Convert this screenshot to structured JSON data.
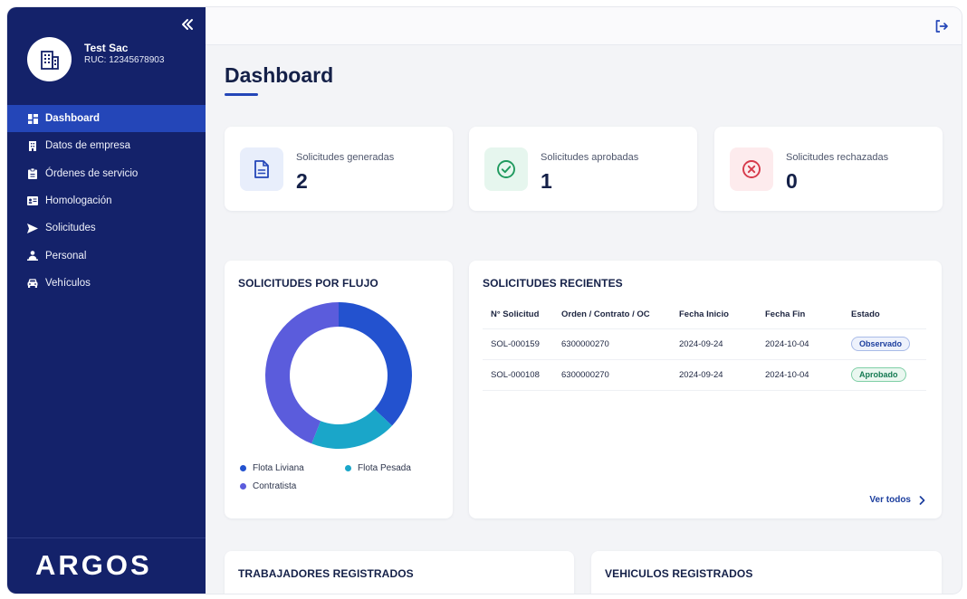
{
  "sidebar": {
    "company_name": "Test Sac",
    "ruc": "RUC: 12345678903",
    "items": [
      {
        "label": "Dashboard",
        "icon": "dashboard-icon",
        "active": true
      },
      {
        "label": "Datos de empresa",
        "icon": "building-icon"
      },
      {
        "label": "Órdenes de servicio",
        "icon": "clipboard-icon"
      },
      {
        "label": "Homologación",
        "icon": "id-card-icon"
      },
      {
        "label": "Solicitudes",
        "icon": "send-icon"
      },
      {
        "label": "Personal",
        "icon": "users-icon"
      },
      {
        "label": "Vehículos",
        "icon": "car-icon"
      }
    ],
    "logo_text": "ARGOS"
  },
  "header": {
    "title": "Dashboard"
  },
  "stats": [
    {
      "label": "Solicitudes generadas",
      "value": "2",
      "icon": "document-icon",
      "color": "#2446b8",
      "bg": "#e8eefb"
    },
    {
      "label": "Solicitudes aprobadas",
      "value": "1",
      "icon": "check-circle-icon",
      "color": "#1f9a5e",
      "bg": "#e6f6ee"
    },
    {
      "label": "Solicitudes rechazadas",
      "value": "0",
      "icon": "x-circle-icon",
      "color": "#d6394a",
      "bg": "#fdebed"
    }
  ],
  "flow_card": {
    "title": "SOLICITUDES POR FLUJO"
  },
  "chart_data": {
    "type": "pie",
    "donut": true,
    "title": "SOLICITUDES POR FLUJO",
    "series": [
      {
        "name": "Flota Liviana",
        "value": 37,
        "color": "#2352cf"
      },
      {
        "name": "Flota Pesada",
        "value": 19,
        "color": "#1aa6c9"
      },
      {
        "name": "Contratista",
        "value": 44,
        "color": "#5b5cdc"
      }
    ],
    "legend": "bottom"
  },
  "recent": {
    "title": "SOLICITUDES RECIENTES",
    "columns": [
      "N° Solicitud",
      "Orden / Contrato / OC",
      "Fecha Inicio",
      "Fecha Fin",
      "Estado"
    ],
    "rows": [
      {
        "id": "SOL-000159",
        "orden": "6300000270",
        "inicio": "2024-09-24",
        "fin": "2024-10-04",
        "estado": "Observado"
      },
      {
        "id": "SOL-000108",
        "orden": "6300000270",
        "inicio": "2024-09-24",
        "fin": "2024-10-04",
        "estado": "Aprobado"
      }
    ],
    "link": "Ver todos"
  },
  "bottom": {
    "workers_title": "TRABAJADORES REGISTRADOS",
    "vehicles_title": "VEHICULOS REGISTRADOS"
  }
}
